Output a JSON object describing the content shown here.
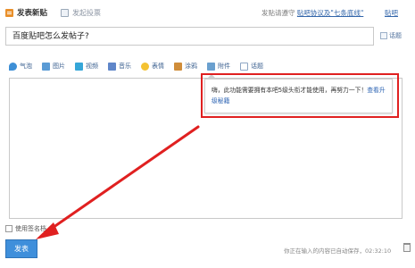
{
  "header": {
    "post_tab": "发表新贴",
    "vote_tab": "发起投票",
    "notice_prefix": "发贴请遵守",
    "notice_link": "贴吧协议及\"七条底线\"",
    "help_link": "贴吧"
  },
  "title_input": {
    "value": "百度贴吧怎么发帖子?"
  },
  "topic_label": "话题",
  "toolbar": {
    "items": [
      {
        "label": "气泡",
        "icon": "bubble-icon"
      },
      {
        "label": "图片",
        "icon": "image-icon"
      },
      {
        "label": "视频",
        "icon": "video-icon"
      },
      {
        "label": "音乐",
        "icon": "music-icon"
      },
      {
        "label": "表情",
        "icon": "emoji-icon"
      },
      {
        "label": "涂鸦",
        "icon": "doodle-icon"
      },
      {
        "label": "附件",
        "icon": "attachment-icon"
      },
      {
        "label": "话题",
        "icon": "topic-icon"
      }
    ]
  },
  "popup": {
    "message": "嗨，此功能需要拥有本吧5级头衔才能使用，再努力一下！",
    "link": "查看升级秘籍"
  },
  "footer": {
    "signature_label": "使用签名档",
    "submit_label": "发表",
    "autosave_text": "你正在输入的内容已自动保存，02:32:10"
  },
  "annotation": {
    "highlight_color": "#e02020",
    "arrow_color": "#e02020"
  }
}
